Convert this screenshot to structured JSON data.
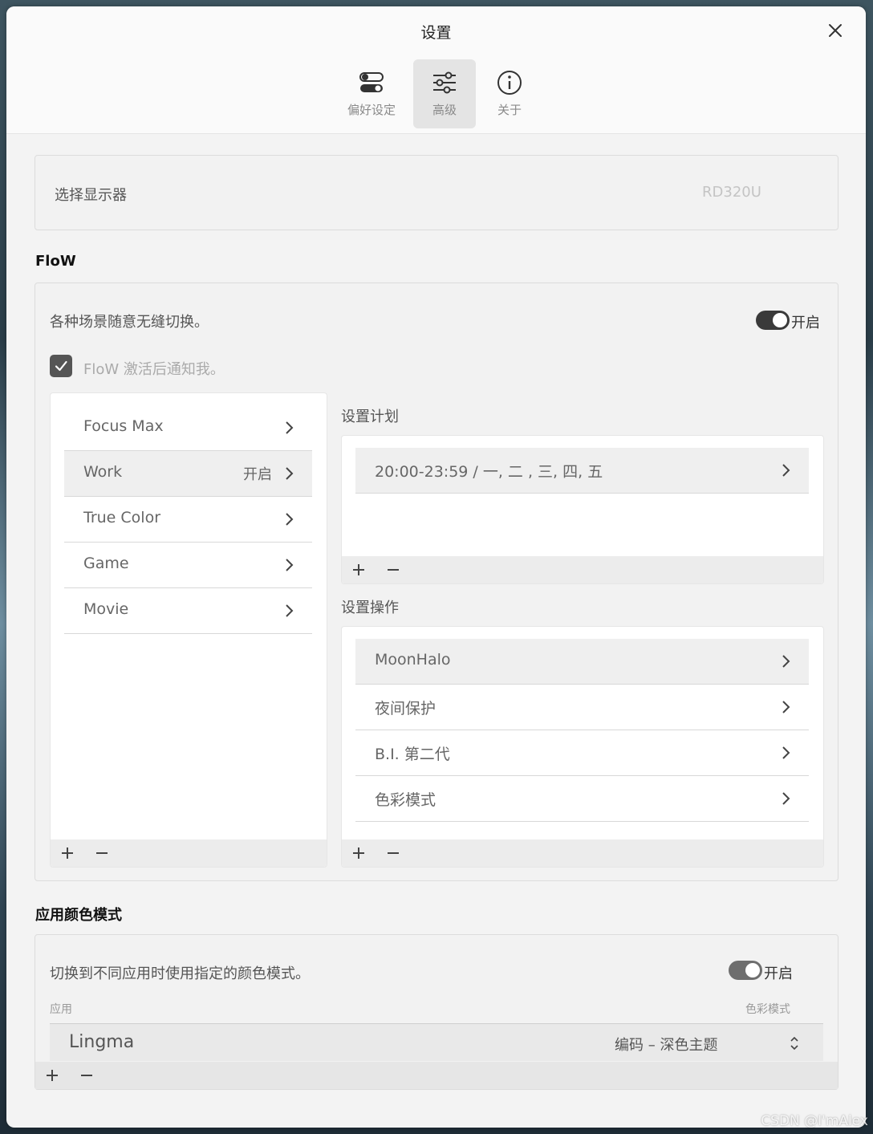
{
  "window": {
    "title": "设置"
  },
  "tabs": [
    {
      "label": "偏好设定",
      "icon": "toggles-icon"
    },
    {
      "label": "高级",
      "icon": "sliders-icon",
      "active": true
    },
    {
      "label": "关于",
      "icon": "info-icon"
    }
  ],
  "monitor": {
    "label": "选择显示器",
    "value": "RD320U"
  },
  "flow": {
    "heading": "FloW",
    "description": "各种场景随意无缝切换。",
    "toggle_label": "开启",
    "toggle_on": true,
    "notify_label": "FloW 激活后通知我。",
    "notify_checked": true,
    "scenes": [
      {
        "label": "Focus Max",
        "status": ""
      },
      {
        "label": "Work",
        "status": "开启",
        "selected": true
      },
      {
        "label": "True Color",
        "status": ""
      },
      {
        "label": "Game",
        "status": ""
      },
      {
        "label": "Movie",
        "status": ""
      }
    ],
    "schedule_heading": "设置计划",
    "schedules": [
      {
        "label": "20:00-23:59  / 一, 二 , 三, 四, 五"
      }
    ],
    "actions_heading": "设置操作",
    "actions": [
      {
        "label": "MoonHalo",
        "selected": true
      },
      {
        "label": "夜间保护"
      },
      {
        "label": "B.I. 第二代"
      },
      {
        "label": "色彩模式"
      }
    ]
  },
  "app_color": {
    "heading": "应用颜色模式",
    "description": "切换到不同应用时使用指定的颜色模式。",
    "toggle_label": "开启",
    "toggle_on": true,
    "col_app": "应用",
    "col_mode": "色彩模式",
    "rows": [
      {
        "app": "Lingma",
        "mode": "编码 – 深色主题"
      }
    ]
  },
  "watermark": "CSDN @I'mAlex",
  "colors": {
    "toggle_on": "#3a3a3a",
    "panel": "#f2f2f2",
    "window": "#f3f3f3"
  }
}
